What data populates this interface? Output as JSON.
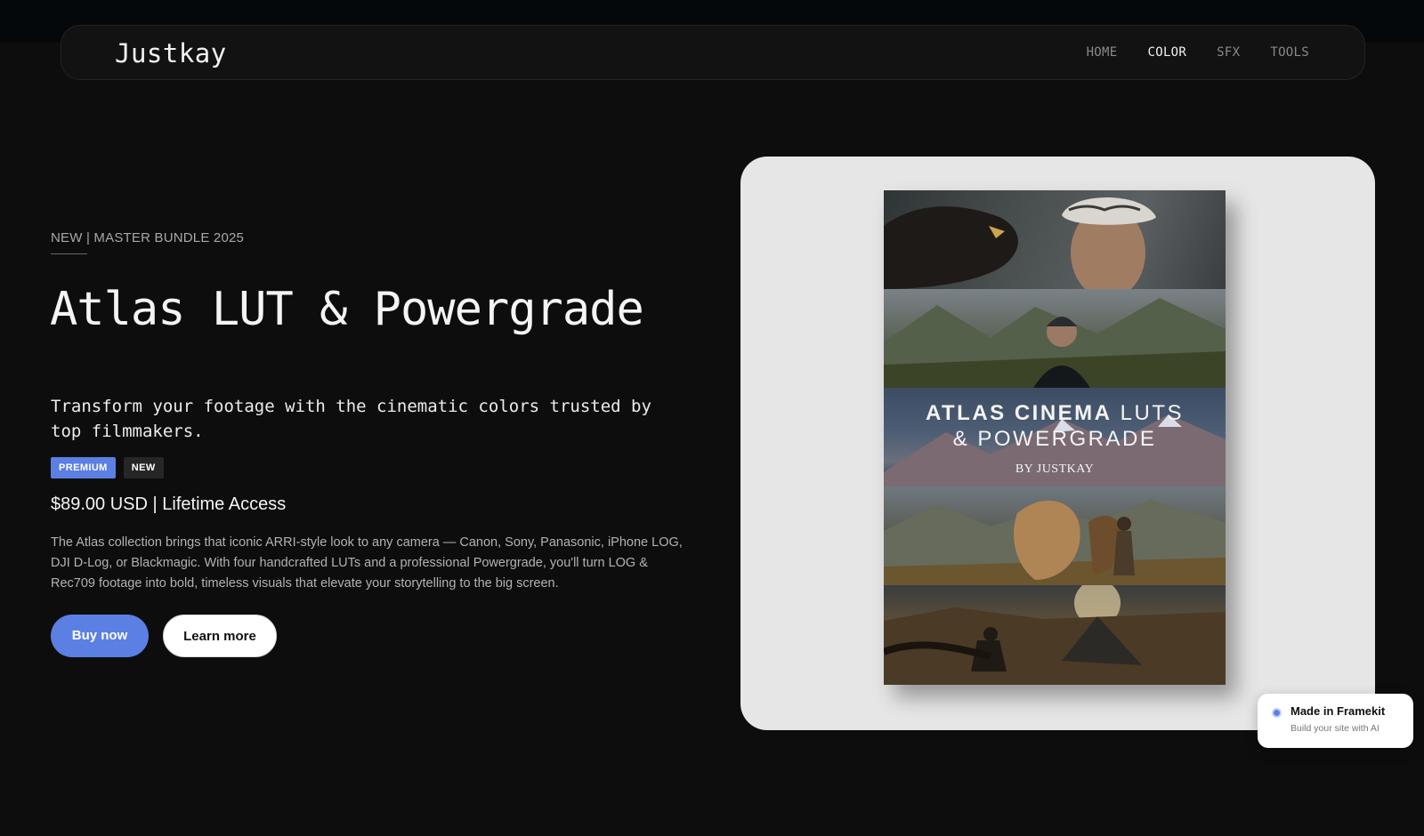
{
  "nav": {
    "logo": "Justkay",
    "items": [
      {
        "label": "HOME",
        "active": false
      },
      {
        "label": "COLOR",
        "active": true
      },
      {
        "label": "SFX",
        "active": false
      },
      {
        "label": "TOOLS",
        "active": false
      }
    ]
  },
  "hero": {
    "eyebrow": "NEW | MASTER BUNDLE 2025",
    "title": "Atlas LUT & Powergrade",
    "subtitle": "Transform your footage with the cinematic colors trusted by top filmmakers.",
    "badges": [
      "PREMIUM",
      "NEW"
    ],
    "price": "$89.00 USD | Lifetime Access",
    "description": "The Atlas collection brings that iconic ARRI-style look to any camera — Canon, Sony, Panasonic, iPhone LOG, DJI D-Log, or Blackmagic. With four handcrafted LUTs and a professional Powergrade, you'll turn LOG & Rec709 footage into bold, timeless visuals that elevate your storytelling to the big screen.",
    "buy_label": "Buy now",
    "learn_label": "Learn more"
  },
  "cover": {
    "title_bold": "ATLAS CINEMA",
    "title_rest": "LUTS",
    "title_line2": "& POWERGRADE",
    "byline": "BY JUSTKAY"
  },
  "framekit": {
    "title": "Made in Framekit",
    "subtitle": "Build your site with AI"
  },
  "colors": {
    "accent": "#5b7fe3",
    "background": "#0d0d0d",
    "card": "#e6e6e6"
  }
}
